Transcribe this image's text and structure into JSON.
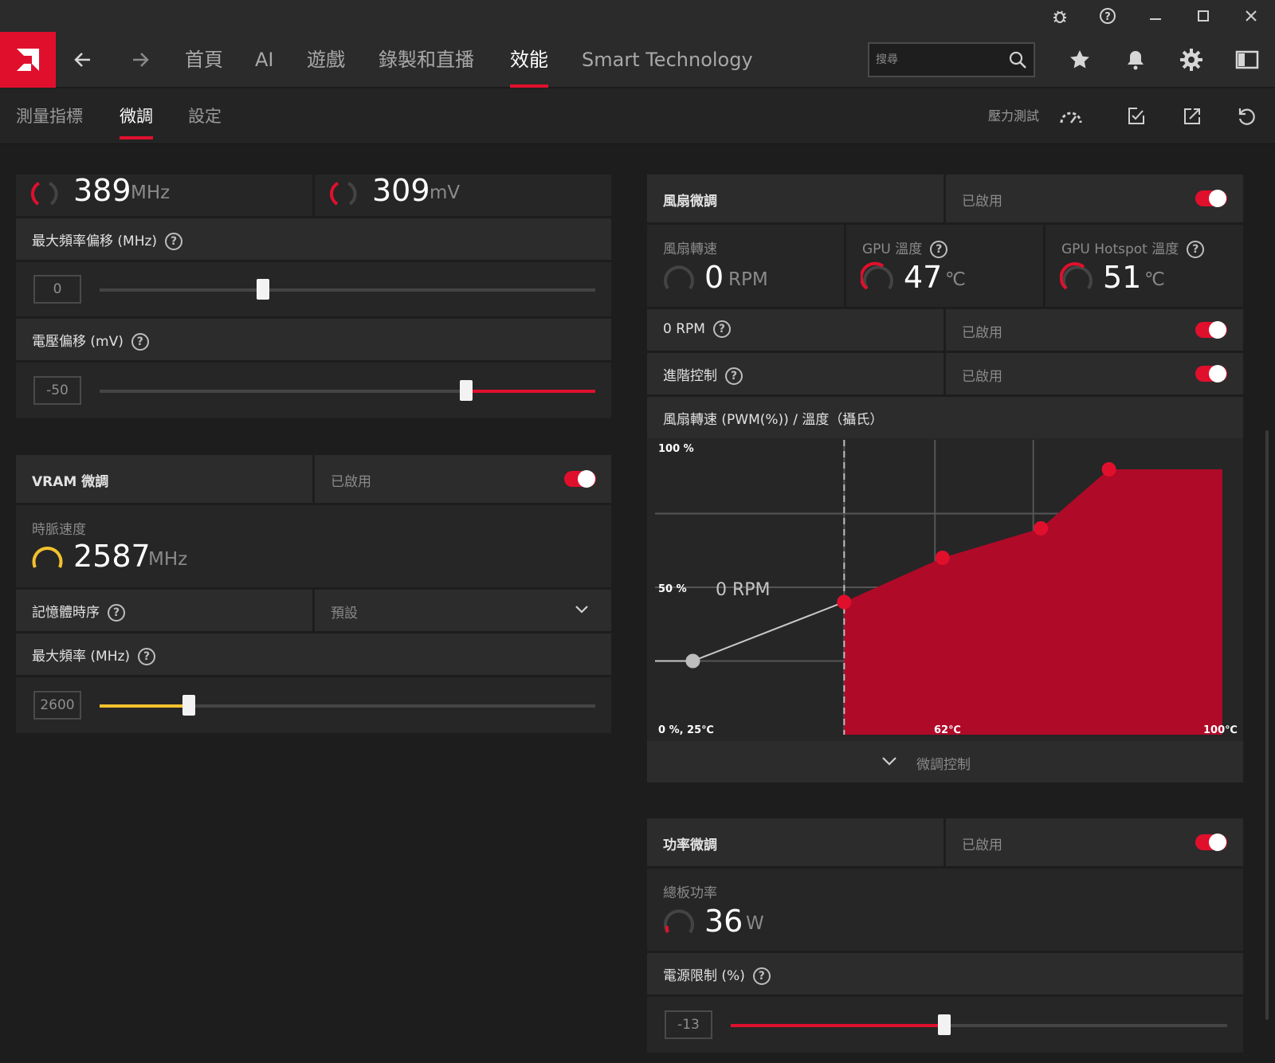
{
  "titlebar": {
    "bug_icon": "bug-icon",
    "help_icon": "help-icon",
    "minimize_icon": "minimize-icon",
    "maximize_icon": "maximize-icon",
    "close_icon": "close-icon"
  },
  "nav": {
    "tabs": [
      {
        "label": "首頁"
      },
      {
        "label": "AI"
      },
      {
        "label": "遊戲"
      },
      {
        "label": "錄製和直播"
      },
      {
        "label": "效能"
      },
      {
        "label": "Smart Technology"
      }
    ],
    "active_tab": "效能",
    "search_placeholder": "搜尋"
  },
  "subnav": {
    "tabs": [
      {
        "label": "測量指標"
      },
      {
        "label": "微調"
      },
      {
        "label": "設定"
      }
    ],
    "active_tab": "微調",
    "stress_test_label": "壓力測試"
  },
  "gpu": {
    "clock_value": "389",
    "clock_unit": "MHz",
    "voltage_value": "309",
    "voltage_unit": "mV",
    "max_freq_offset_label": "最大頻率偏移 (MHz)",
    "max_freq_offset_value": "0",
    "max_freq_offset_fraction": 0.33,
    "voltage_offset_label": "電壓偏移 (mV)",
    "voltage_offset_value": "-50",
    "voltage_offset_fraction": 0.74
  },
  "vram": {
    "title": "VRAM 微調",
    "status": "已啟用",
    "clock_label": "時脈速度",
    "clock_value": "2587",
    "clock_unit": "MHz",
    "timing_label": "記憶體時序",
    "timing_value": "預設",
    "max_freq_label": "最大頻率 (MHz)",
    "max_freq_value": "2600",
    "max_freq_fraction": 0.18
  },
  "fan": {
    "title": "風扇微調",
    "status": "已啟用",
    "speed_label": "風扇轉速",
    "speed_value": "0",
    "speed_unit": "RPM",
    "gpu_temp_label": "GPU 溫度",
    "gpu_temp_value": "47",
    "gpu_temp_unit": "℃",
    "hotspot_label": "GPU Hotspot 溫度",
    "hotspot_value": "51",
    "hotspot_unit": "℃",
    "zero_rpm_label": "0 RPM",
    "zero_rpm_status": "已啟用",
    "advanced_label": "進階控制",
    "advanced_status": "已啟用",
    "curve_label": "風扇轉速 (PWM(%)) / 溫度（攝氏）",
    "fine_tune_label": "微調控制"
  },
  "chart_data": {
    "type": "area",
    "x_unit": "℃",
    "y_unit": "%",
    "xlim": [
      25,
      100
    ],
    "ylim": [
      0,
      100
    ],
    "tick_labels": {
      "y_top": "100 %",
      "y_mid": "50 %",
      "origin": "0 %, 25℃",
      "x_mid": "62℃",
      "x_max": "100℃"
    },
    "zero_rpm_label": "0 RPM",
    "zero_rpm_threshold": 50,
    "points": [
      {
        "x": 30,
        "y": 25
      },
      {
        "x": 50,
        "y": 45
      },
      {
        "x": 63,
        "y": 60
      },
      {
        "x": 76,
        "y": 70
      },
      {
        "x": 85,
        "y": 90
      }
    ],
    "end_value": {
      "x": 100,
      "y": 90
    },
    "grid": true,
    "colors": {
      "fill": "#b00a29",
      "point": "#e0102d",
      "inactive_point": "#bdbdbd",
      "line": "#c8c8c8"
    }
  },
  "power": {
    "title": "功率微調",
    "status": "已啟用",
    "board_label": "總板功率",
    "board_value": "36",
    "board_unit": "W",
    "limit_label": "電源限制 (%)",
    "limit_value": "-13",
    "limit_fraction": 0.43
  },
  "colors": {
    "accent": "#e0102d",
    "yellow": "#f2c12e",
    "bg": "#1d1d1d"
  }
}
